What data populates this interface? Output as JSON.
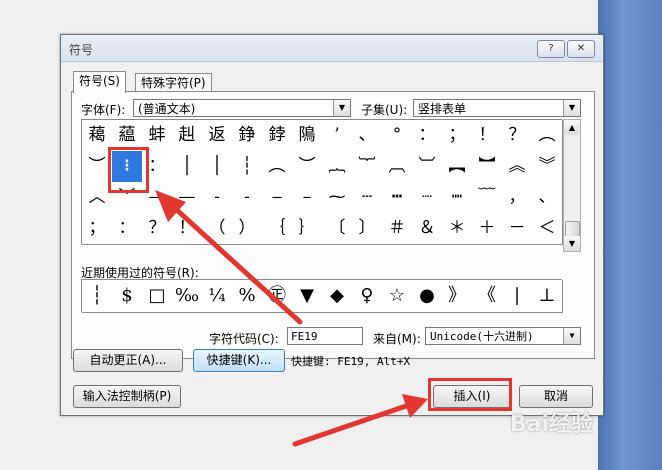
{
  "window": {
    "title": "符号",
    "help_btn": "?",
    "close_btn": "✕"
  },
  "tabs": [
    {
      "label": "符号(S)"
    },
    {
      "label": "特殊字符(P)"
    }
  ],
  "font": {
    "label": "字体(F):",
    "value": "(普通文本)"
  },
  "subset": {
    "label": "子集(U):",
    "value": "竖排表单"
  },
  "symbols": [
    [
      "藒",
      "藴",
      "蚌",
      "赳",
      "返",
      "錚",
      "鋍",
      "隝",
      "’",
      "、",
      "°",
      "：",
      "；",
      "！",
      "？",
      "︵"
    ],
    [
      "︶",
      "⁝",
      "：",
      "│",
      "│",
      "┆",
      "︵",
      "︶",
      "︷",
      "︸",
      "︹",
      "︺",
      "︻",
      "︼",
      "︽",
      "︾"
    ],
    [
      "︿",
      "﹀",
      "—",
      "—",
      "‐",
      "‐",
      "‒",
      "–",
      "⁓",
      "┄",
      "┅",
      "┈",
      "┉",
      "﹋",
      "，",
      "、",
      "."
    ],
    [
      "；",
      "：",
      "？",
      "！",
      "（",
      "）",
      "｛",
      "｝",
      "〔",
      "〕",
      "＃",
      "＆",
      "＊",
      "＋",
      "－",
      "＜"
    ]
  ],
  "recent_label": "近期使用过的符号(R):",
  "recent": [
    "┆",
    "$",
    "□",
    "‰",
    "¼",
    "%",
    "㊣",
    "▼",
    "◆",
    "♀",
    "☆",
    "●",
    "》",
    "《",
    "|",
    "⊥"
  ],
  "char_code": {
    "label": "字符代码(C):",
    "value": "FE19"
  },
  "from": {
    "label": "来自(M):",
    "value": "Unicode(十六进制)"
  },
  "buttons": {
    "autocorrect": "自动更正(A)...",
    "shortcut": "快捷键(K)...",
    "shortcut_info": "快捷键: FE19, Alt+X",
    "ime": "输入法控制柄(P)",
    "insert": "插入(I)",
    "cancel": "取消"
  },
  "watermark": "Bai经验",
  "colors": {
    "highlight": "#e2362e",
    "selected_cell": "#2e78e0"
  }
}
